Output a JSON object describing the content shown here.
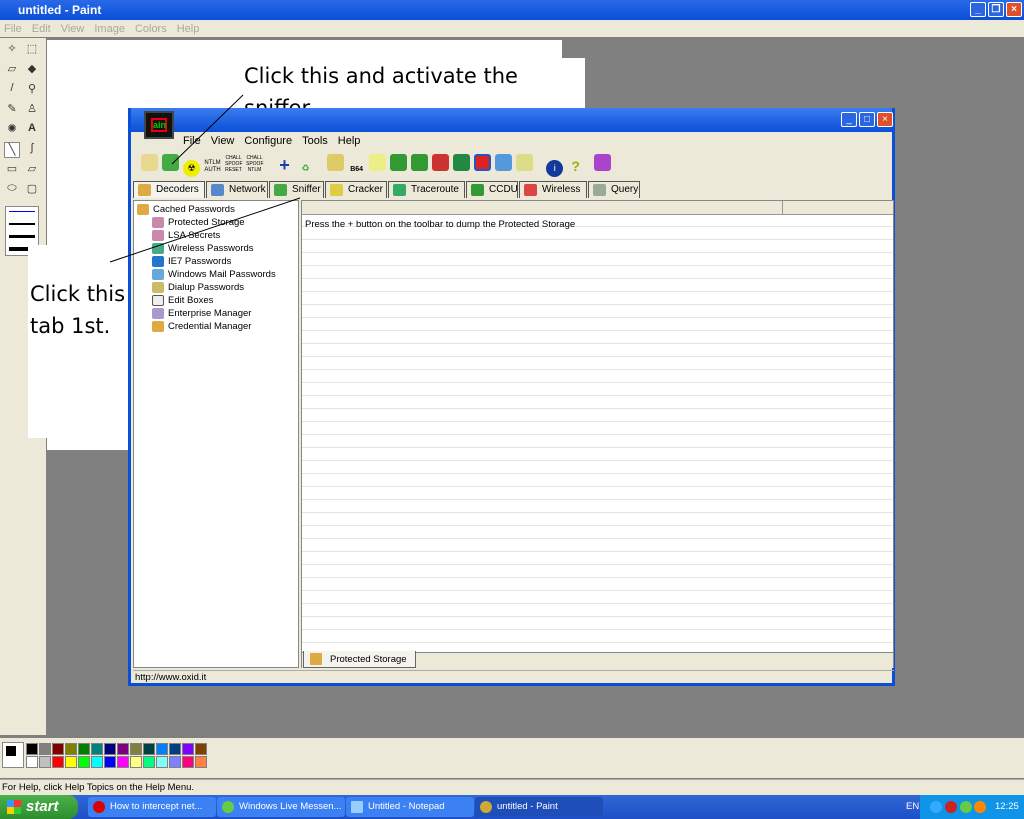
{
  "paint": {
    "title": "untitled - Paint",
    "menu": [
      "File",
      "Edit",
      "View",
      "Image",
      "Colors",
      "Help"
    ],
    "status": "For Help, click Help Topics on the Help Menu."
  },
  "callouts": {
    "top": "Click this and activate the sniffer.",
    "left": "Click this tab 1st."
  },
  "cain": {
    "menu": [
      "File",
      "View",
      "Configure",
      "Tools",
      "Help"
    ],
    "toolbar_text": {
      "ntlm": "NTLM AUTH",
      "chall1": "CHALL SPOOF RESET",
      "chall2": "CHALL SPOOF NTLM",
      "b64": "B64"
    },
    "tabs": [
      "Decoders",
      "Network",
      "Sniffer",
      "Cracker",
      "Traceroute",
      "CCDU",
      "Wireless",
      "Query"
    ],
    "tree": {
      "root": "Cached Passwords",
      "items": [
        "Protected Storage",
        "LSA Secrets",
        "Wireless Passwords",
        "IE7 Passwords",
        "Windows Mail Passwords",
        "Dialup Passwords",
        "Edit Boxes",
        "Enterprise Manager",
        "Credential Manager"
      ]
    },
    "list_message": "Press the + button on the toolbar to dump the Protected Storage",
    "bottom_tab": "Protected Storage",
    "status": "http://www.oxid.it"
  },
  "palette": [
    "#000000",
    "#808080",
    "#800000",
    "#808000",
    "#008000",
    "#008080",
    "#000080",
    "#800080",
    "#808040",
    "#004040",
    "#0080ff",
    "#004080",
    "#8000ff",
    "#804000",
    "#ffffff",
    "#c0c0c0",
    "#ff0000",
    "#ffff00",
    "#00ff00",
    "#00ffff",
    "#0000ff",
    "#ff00ff",
    "#ffff80",
    "#00ff80",
    "#80ffff",
    "#8080ff",
    "#ff0080",
    "#ff8040"
  ],
  "taskbar": {
    "start": "start",
    "tasks": [
      "How to intercept net...",
      "Windows Live Messen...",
      "Untitled - Notepad",
      "untitled - Paint"
    ],
    "lang": "EN",
    "clock": "12:25"
  }
}
